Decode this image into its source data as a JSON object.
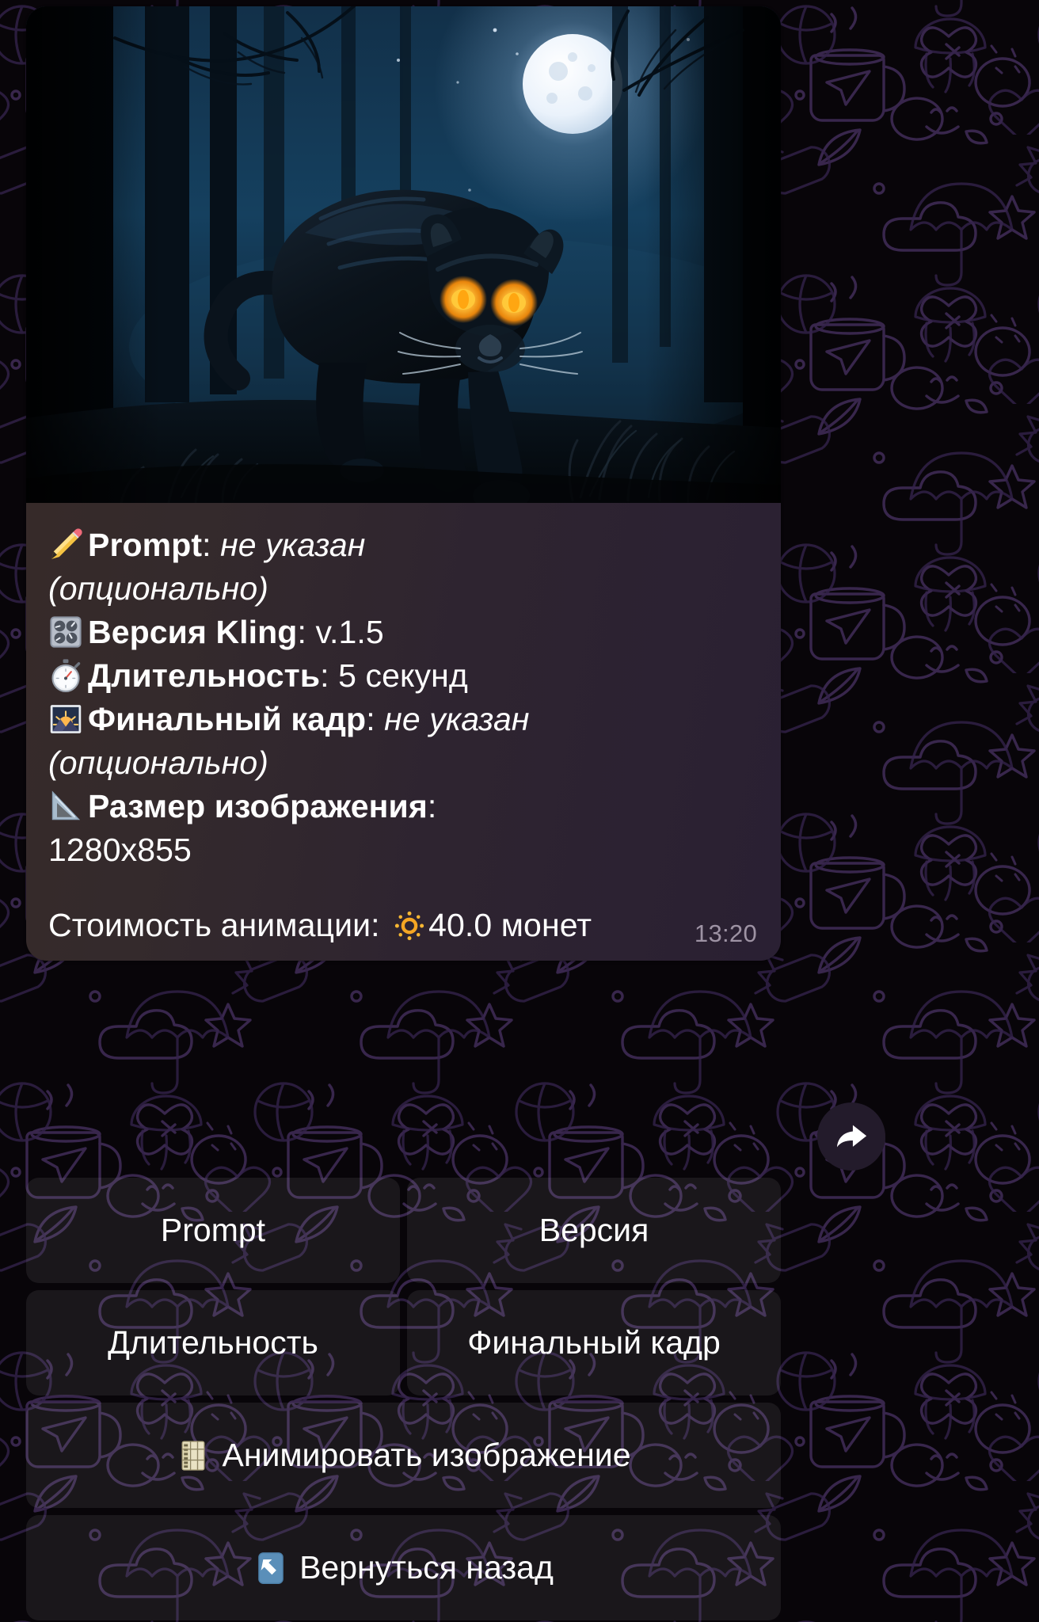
{
  "message": {
    "photo": {
      "alt": "black-panther-in-moonlit-forest",
      "moon_color": "#f2f6ff",
      "sky_color": "#16334d",
      "eye_color": "#ffa519"
    },
    "caption": {
      "rows": [
        {
          "icon": "pencil-icon",
          "label": "Prompt",
          "sep": ": ",
          "value": "не указан",
          "value_style": "italic",
          "cont": "(опционально)"
        },
        {
          "icon": "control-knobs-icon",
          "label": "Версия Kling",
          "sep": ": ",
          "value": "v.1.5",
          "value_style": "normal",
          "cont": ""
        },
        {
          "icon": "stopwatch-icon",
          "label": "Длительность",
          "sep": ": ",
          "value": "5 секунд",
          "value_style": "normal",
          "cont": ""
        },
        {
          "icon": "sunrise-photo-icon",
          "label": "Финальный кадр",
          "sep": ": ",
          "value": "не указан",
          "value_style": "italic",
          "cont": "(опционально)"
        },
        {
          "icon": "triangle-ruler-icon",
          "label": "Размер изображения",
          "sep": ": ",
          "value": "1280x855",
          "value_style": "normal",
          "cont": ""
        }
      ],
      "cost_prefix": "Стоимость анимации: ",
      "cost_icon": "sun-coin-icon",
      "cost_value": "40.0",
      "cost_suffix": " монет"
    },
    "timestamp": "13:20",
    "forward_icon": "forward-arrow-icon"
  },
  "keyboard": {
    "rows": [
      [
        {
          "label": "Prompt",
          "icon": ""
        },
        {
          "label": "Версия",
          "icon": ""
        }
      ],
      [
        {
          "label": "Длительность",
          "icon": ""
        },
        {
          "label": "Финальный кадр",
          "icon": ""
        }
      ],
      [
        {
          "label": "Анимировать изображение",
          "icon": "film-frames-icon"
        }
      ],
      [
        {
          "label": "Вернуться назад",
          "icon": "back-arrow-icon"
        }
      ]
    ]
  },
  "theme": {
    "bubble_left": "#372a27",
    "bubble_right": "#2a2033",
    "page_bg": "#080509",
    "doodle_stroke": "#36254a",
    "button_bg": "rgba(255,255,255,0.075)",
    "text": "#ffffff",
    "timestamp_color": "#9e93a4"
  }
}
